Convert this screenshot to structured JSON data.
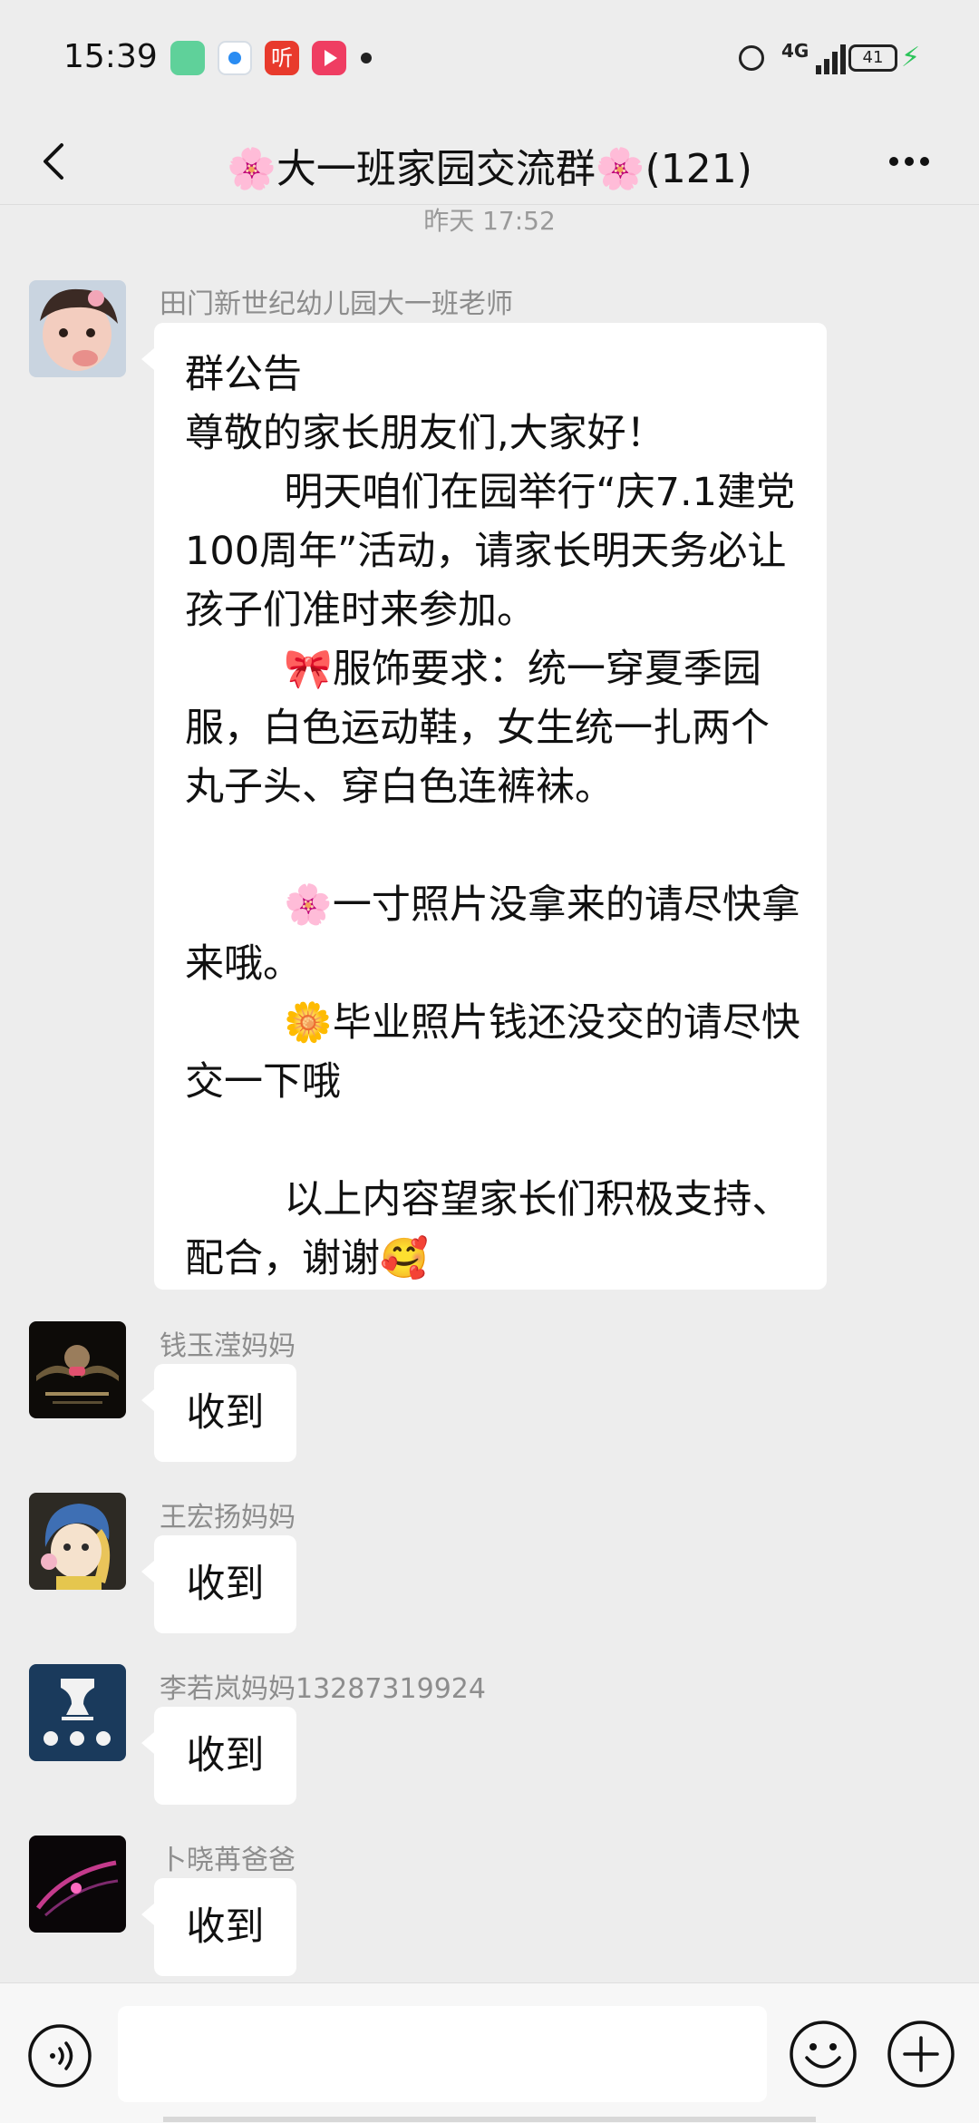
{
  "status_bar": {
    "time": "15:39",
    "app_icons": [
      "green-app-icon",
      "browser-icon",
      "ting-app-icon",
      "video-app-icon"
    ],
    "ting_label": "听",
    "network_label": "4G",
    "battery": "41"
  },
  "header": {
    "title": "🌸大一班家园交流群🌸(121)",
    "back_icon": "chevron-left-icon",
    "more_icon": "more-dots-icon"
  },
  "chat": {
    "timestamp": "昨天 17:52",
    "messages": [
      {
        "sender": "田门新世纪幼儿园大一班老师",
        "text": "群公告\n尊敬的家长朋友们,大家好！\n        明天咱们在园举行“庆7.1建党100周年”活动，请家长明天务必让孩子们准时来参加。\n        🎀服饰要求：统一穿夏季园服，白色运动鞋，女生统一扎两个丸子头、穿白色连裤袜。\n\n        🌸一寸照片没拿来的请尽快拿来哦。\n        🌼毕业照片钱还没交的请尽快交一下哦\n\n        以上内容望家长们积极支持、配合，谢谢🥰"
      },
      {
        "sender": "钱玉滢妈妈",
        "text": "收到"
      },
      {
        "sender": "王宏扬妈妈",
        "text": "收到"
      },
      {
        "sender": "李若岚妈妈13287319924",
        "text": "收到"
      },
      {
        "sender": "卜晓苒爸爸",
        "text": "收到"
      }
    ]
  },
  "input_bar": {
    "voice_icon": "voice-icon",
    "input_value": "",
    "emoji_icon": "emoji-icon",
    "plus_icon": "plus-icon"
  },
  "colors": {
    "background": "#ededed",
    "bubble": "#ffffff",
    "sender_name": "#8d8d8d",
    "timestamp": "#9a9a9a",
    "charging": "#2cc45a"
  }
}
